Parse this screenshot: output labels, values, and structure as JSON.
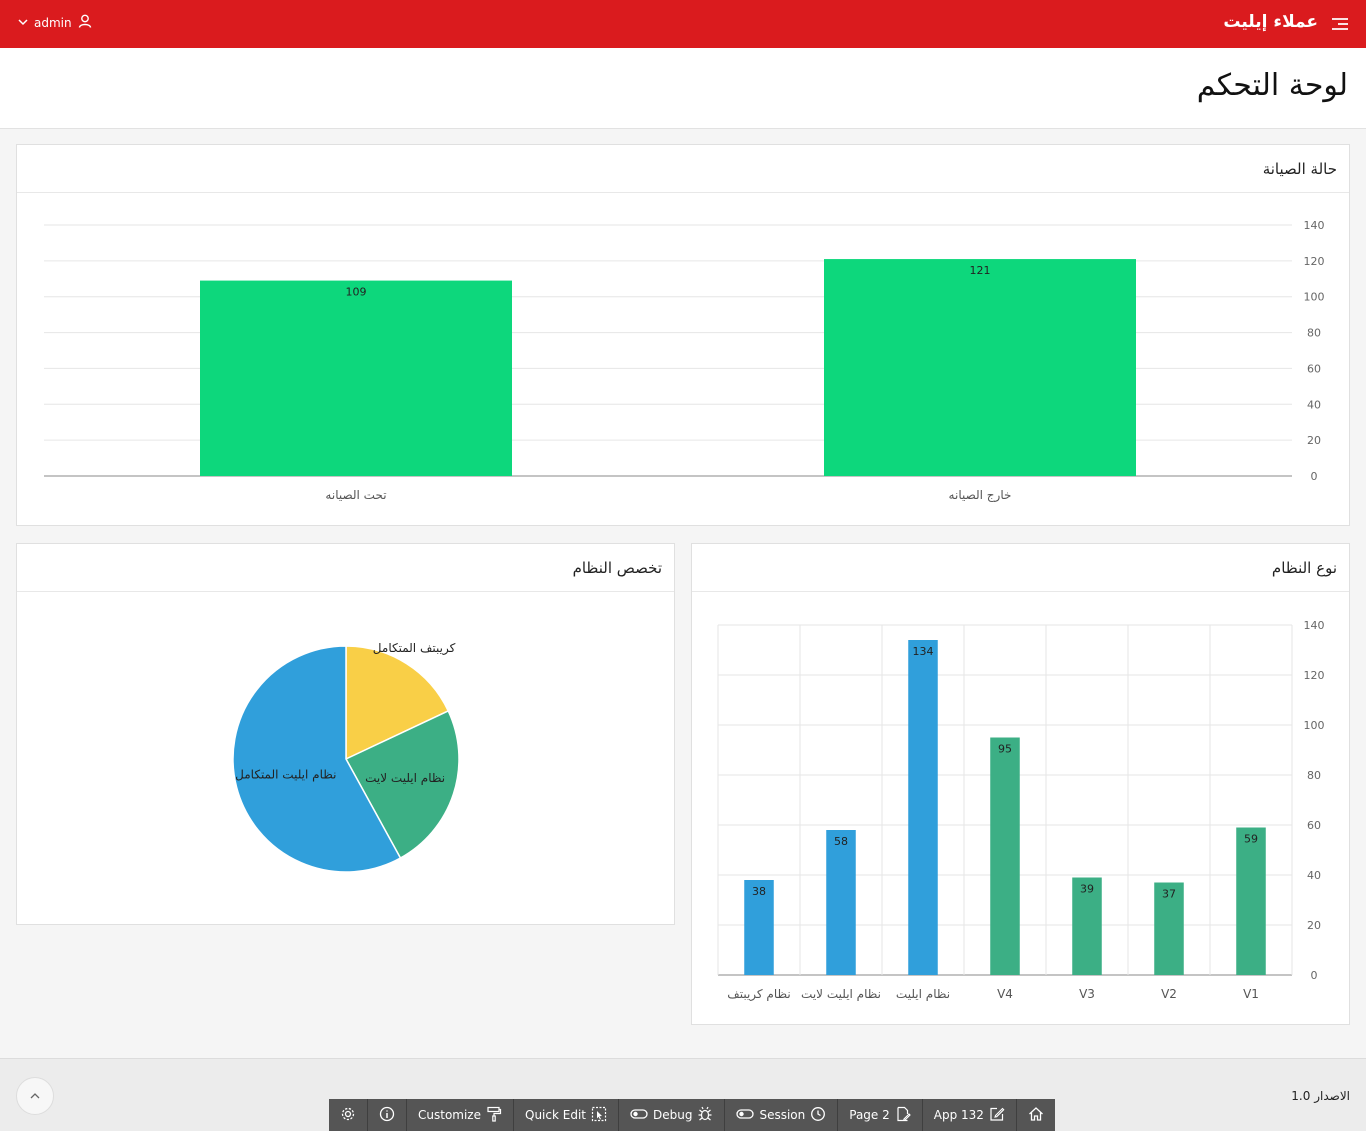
{
  "header": {
    "app_name": "عملاء إيليت",
    "user": "admin"
  },
  "page": {
    "title": "لوحة التحكم"
  },
  "regions": {
    "maintenance": {
      "title": "حالة الصيانة"
    },
    "specialization": {
      "title": "تخصص النظام"
    },
    "system_type": {
      "title": "نوع النظام"
    }
  },
  "chart_data": [
    {
      "type": "bar",
      "title": "حالة الصيانة",
      "categories": [
        "خارج الصيانه",
        "تحت الصيانه"
      ],
      "values": [
        121,
        109
      ],
      "ylim": [
        0,
        140
      ],
      "yticks": [
        0,
        20,
        40,
        60,
        80,
        100,
        120,
        140
      ],
      "grid": true,
      "color": "#0dd77c"
    },
    {
      "type": "pie",
      "title": "تخصص النظام",
      "categories": [
        "كريبتف المتكامل",
        "نظام ايليت لايت",
        "نظام ايليت المتكامل"
      ],
      "values": [
        18,
        24,
        58
      ],
      "colors": [
        "#f9cf47",
        "#3caf85",
        "#309fdb"
      ]
    },
    {
      "type": "bar",
      "title": "نوع النظام",
      "categories": [
        "V1",
        "V2",
        "V3",
        "V4",
        "نظام ايليت",
        "نظام ايليت لايت",
        "نظام كريبتف"
      ],
      "values": [
        59,
        37,
        39,
        95,
        134,
        58,
        38
      ],
      "colors": [
        "#3caf85",
        "#3caf85",
        "#3caf85",
        "#3caf85",
        "#309fdb",
        "#309fdb",
        "#309fdb"
      ],
      "ylim": [
        0,
        140
      ],
      "yticks": [
        0,
        20,
        40,
        60,
        80,
        100,
        120,
        140
      ],
      "grid": true
    }
  ],
  "footer": {
    "version": "الاصدار 1.0"
  },
  "devbar": {
    "customize": "Customize",
    "quick_edit": "Quick Edit",
    "debug": "Debug",
    "session": "Session",
    "page": "Page 2",
    "app": "App 132"
  }
}
